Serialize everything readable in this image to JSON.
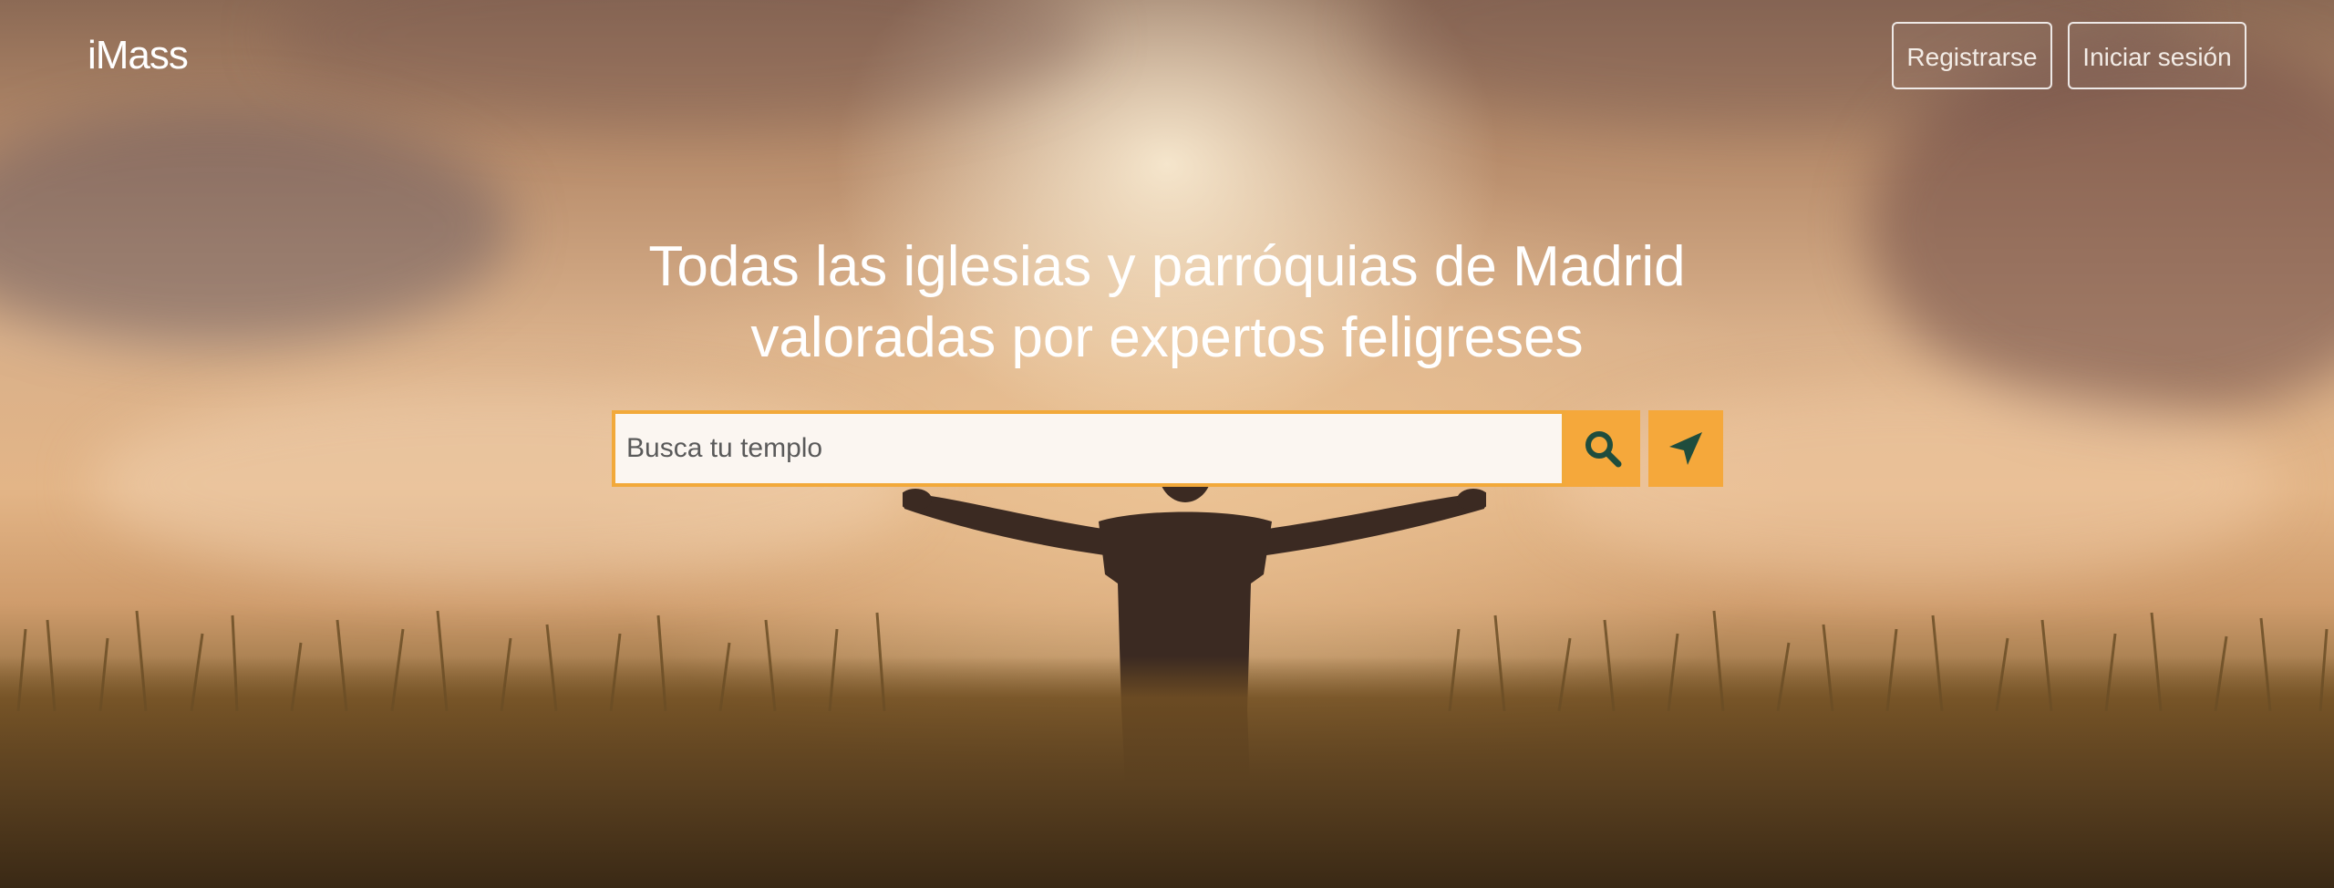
{
  "header": {
    "logo": "iMass",
    "register_label": "Registrarse",
    "login_label": "Iniciar sesión"
  },
  "hero": {
    "headline_line1": "Todas las iglesias y parróquias de Madrid",
    "headline_line2": "valoradas por expertos feligreses"
  },
  "search": {
    "placeholder": "Busca tu templo",
    "value": "",
    "search_icon": "search-icon",
    "locate_icon": "location-arrow-icon"
  },
  "colors": {
    "accent": "#f5a83b",
    "icon_color": "#1f4d3d",
    "text": "#ffffff"
  }
}
